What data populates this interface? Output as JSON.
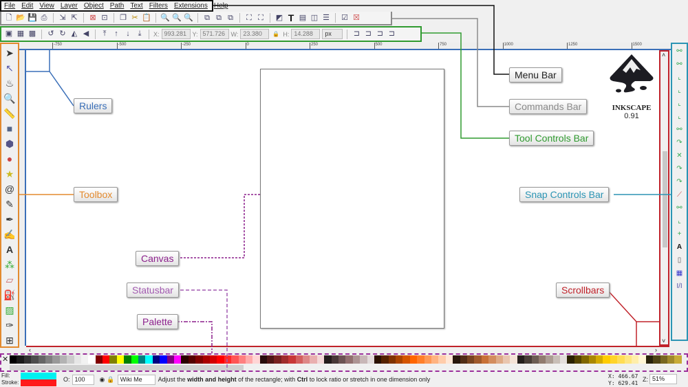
{
  "menu": [
    "File",
    "Edit",
    "View",
    "Layer",
    "Object",
    "Path",
    "Text",
    "Filters",
    "Extensions",
    "Help"
  ],
  "tool_controls": {
    "x_label": "X:",
    "x": "993.281",
    "y_label": "Y:",
    "y": "571.726",
    "w_label": "W:",
    "w": "23.380",
    "h_label": "H:",
    "h": "14.288",
    "unit": "px"
  },
  "ruler_ticks": [
    "-750",
    "-500",
    "-250",
    "0",
    "250",
    "500",
    "750",
    "1000",
    "1250",
    "1500"
  ],
  "logo": {
    "name": "INKSCAPE",
    "version": "0.91"
  },
  "callouts": {
    "menu_bar": "Menu Bar",
    "commands_bar": "Commands Bar",
    "tool_controls_bar": "Tool Controls Bar",
    "rulers": "Rulers",
    "toolbox": "Toolbox",
    "snap_controls_bar": "Snap Controls Bar",
    "canvas": "Canvas",
    "statusbar": "Statusbar",
    "palette": "Palette",
    "scrollbars": "Scrollbars"
  },
  "callout_colors": {
    "menu_bar": "#111111",
    "commands_bar": "#8a8a8a",
    "tool_controls_bar": "#2f9a2f",
    "rulers": "#3a6fb8",
    "toolbox": "#e38a2e",
    "snap_controls_bar": "#2b94b4",
    "canvas": "#8b1f8b",
    "statusbar": "#a25ab0",
    "palette": "#8b1f8b",
    "scrollbars": "#c0222a"
  },
  "palette": [
    "#000000",
    "#1a1a1a",
    "#333333",
    "#4d4d4d",
    "#666666",
    "#808080",
    "#999999",
    "#b3b3b3",
    "#cccccc",
    "#e6e6e6",
    "#f2f2f2",
    "#ffffff",
    "#800000",
    "#ff0000",
    "#808000",
    "#ffff00",
    "#008000",
    "#00ff00",
    "#008080",
    "#00ffff",
    "#000080",
    "#0000ff",
    "#800080",
    "#ff00ff",
    "#2b0000",
    "#550000",
    "#800000",
    "#aa0000",
    "#d40000",
    "#ff0000",
    "#ff2a2a",
    "#ff5555",
    "#ff8080",
    "#ffaaaa",
    "#ffd5d5",
    "#280b0b",
    "#501616",
    "#782121",
    "#a02c2c",
    "#c83737",
    "#d35f5f",
    "#de8787",
    "#e9afaf",
    "#f4d7d7",
    "#241c1c",
    "#483737",
    "#6c5353",
    "#916f6f",
    "#ac9393",
    "#c8b7b7",
    "#e3dbdb",
    "#2b1100",
    "#552200",
    "#803300",
    "#aa4400",
    "#d45500",
    "#ff6600",
    "#ff7f2a",
    "#ff9955",
    "#ffb380",
    "#ffccaa",
    "#ffe6d5",
    "#28170b",
    "#502d16",
    "#784421",
    "#a05a2c",
    "#c87137",
    "#d38d5f",
    "#deaa87",
    "#e9c6af",
    "#f4e3d7",
    "#241f1c",
    "#483e37",
    "#6c5d53",
    "#917c6f",
    "#ac9d93",
    "#c8beb7",
    "#e3dedb",
    "#2b2200",
    "#554400",
    "#806600",
    "#aa8800",
    "#d4aa00",
    "#ffcc00",
    "#ffd42a",
    "#ffdd55",
    "#ffe680",
    "#ffeeaa",
    "#fff6d5",
    "#28220b",
    "#504416",
    "#786721",
    "#a0892c",
    "#c8ab37"
  ],
  "status": {
    "fill_label": "Fill:",
    "stroke_label": "Stroke:",
    "fill_color": "#00f0f0",
    "stroke_color": "#ff1a1a",
    "opacity_label": "O:",
    "opacity": "100",
    "layer": "Wiki Me",
    "message_pre": "Adjust the ",
    "message_b1": "width and height",
    "message_mid": " of the rectangle; with ",
    "message_b2": "Ctrl",
    "message_post": " to lock ratio or stretch in one dimension only",
    "x_label": "X:",
    "x": "466.67",
    "y_label": "Y:",
    "y": "629.41",
    "zoom_label": "Z:",
    "zoom": "51%"
  }
}
